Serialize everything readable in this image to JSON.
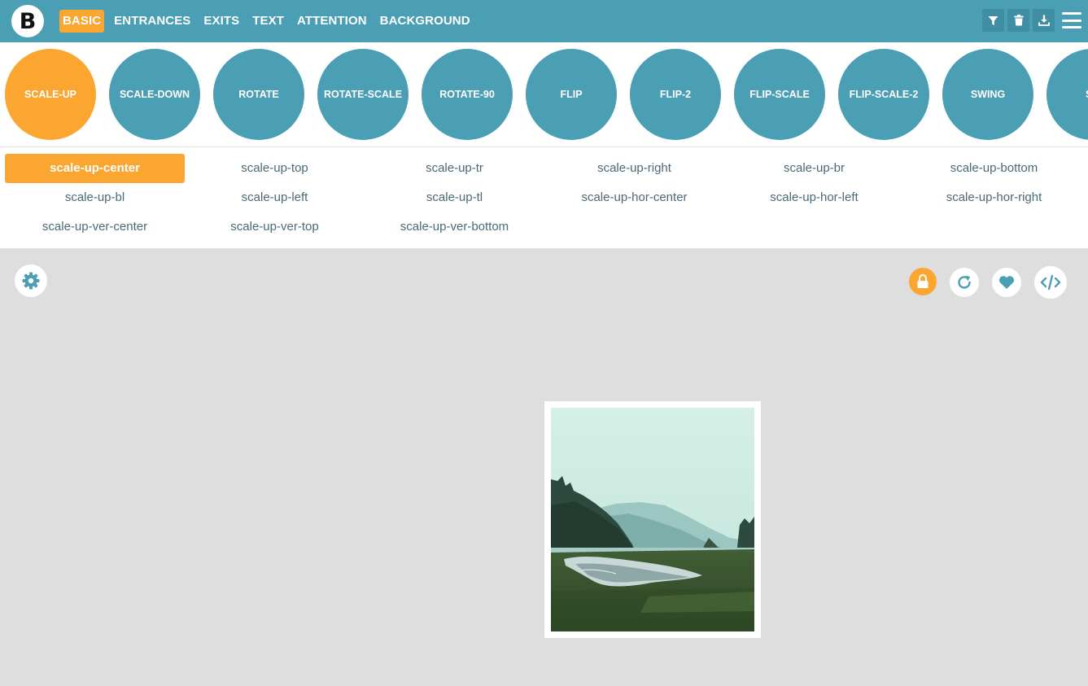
{
  "app": {
    "logo_letter": "B"
  },
  "nav": {
    "items": [
      {
        "label": "BASIC",
        "active": true
      },
      {
        "label": "ENTRANCES",
        "active": false
      },
      {
        "label": "EXITS",
        "active": false
      },
      {
        "label": "TEXT",
        "active": false
      },
      {
        "label": "ATTENTION",
        "active": false
      },
      {
        "label": "BACKGROUND",
        "active": false
      }
    ]
  },
  "toolbar": {
    "icons": [
      "filter-icon",
      "trash-icon",
      "download-icon",
      "hamburger-menu-icon"
    ]
  },
  "categories": {
    "items": [
      {
        "label": "SCALE-UP",
        "active": true
      },
      {
        "label": "SCALE-DOWN",
        "active": false
      },
      {
        "label": "ROTATE",
        "active": false
      },
      {
        "label": "ROTATE-SCALE",
        "active": false
      },
      {
        "label": "ROTATE-90",
        "active": false
      },
      {
        "label": "FLIP",
        "active": false
      },
      {
        "label": "FLIP-2",
        "active": false
      },
      {
        "label": "FLIP-SCALE",
        "active": false
      },
      {
        "label": "FLIP-SCALE-2",
        "active": false
      },
      {
        "label": "SWING",
        "active": false
      },
      {
        "label": "SL",
        "active": false
      }
    ]
  },
  "variants": {
    "items": [
      {
        "label": "scale-up-center",
        "active": true
      },
      {
        "label": "scale-up-top",
        "active": false
      },
      {
        "label": "scale-up-tr",
        "active": false
      },
      {
        "label": "scale-up-right",
        "active": false
      },
      {
        "label": "scale-up-br",
        "active": false
      },
      {
        "label": "scale-up-bottom",
        "active": false
      },
      {
        "label": "scale-up-bl",
        "active": false
      },
      {
        "label": "scale-up-left",
        "active": false
      },
      {
        "label": "scale-up-tl",
        "active": false
      },
      {
        "label": "scale-up-hor-center",
        "active": false
      },
      {
        "label": "scale-up-hor-left",
        "active": false
      },
      {
        "label": "scale-up-hor-right",
        "active": false
      },
      {
        "label": "scale-up-ver-center",
        "active": false
      },
      {
        "label": "scale-up-ver-top",
        "active": false
      },
      {
        "label": "scale-up-ver-bottom",
        "active": false
      }
    ]
  },
  "stage": {
    "icons": [
      "gear-icon",
      "lock-icon",
      "refresh-icon",
      "heart-icon",
      "code-icon"
    ]
  },
  "colors": {
    "accent": "#fba630",
    "primary": "#4a9fb5",
    "stage_bg": "#dedede"
  }
}
